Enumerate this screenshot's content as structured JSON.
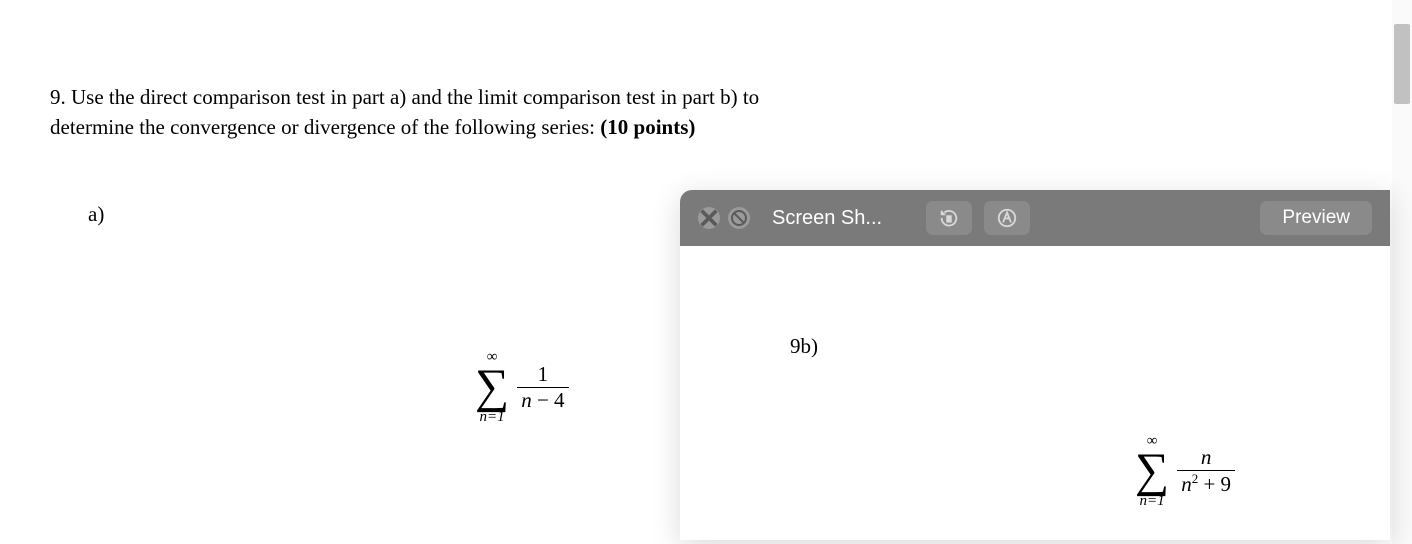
{
  "question": {
    "line1": "9. Use the direct comparison test in part a) and the limit comparison test in part b) to",
    "line2_pre": "determine the convergence or divergence of the following series: ",
    "line2_bold": "(10 points)"
  },
  "partA": {
    "label": "a)",
    "sigma_upper": "∞",
    "sigma_lower": "n=1",
    "numerator": "1",
    "denominator_var": "n",
    "denominator_op": " − 4"
  },
  "previewWindow": {
    "title": "Screen Sh...",
    "appName": "Preview"
  },
  "partB": {
    "label": "9b)",
    "sigma_upper": "∞",
    "sigma_lower": "n=1",
    "numerator": "n",
    "denom_var": "n",
    "denom_sup": "2",
    "denom_rest": " + 9"
  }
}
